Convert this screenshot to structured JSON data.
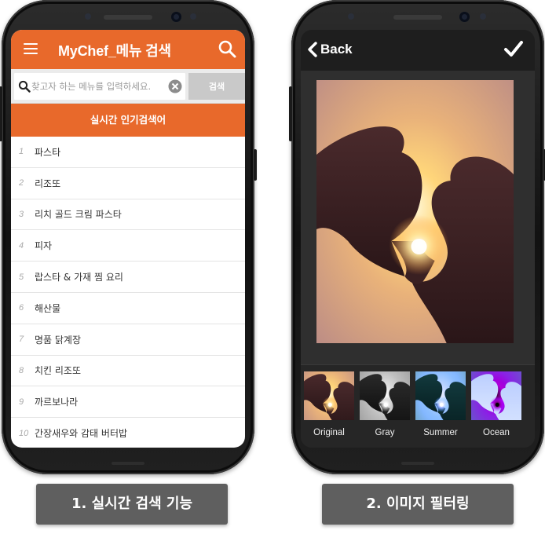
{
  "left_phone": {
    "app_title": "MyChef_메뉴 검색",
    "icons": {
      "menu": "hamburger-menu-icon",
      "search": "search-icon",
      "clear": "clear-icon",
      "input_search": "magnifier-icon"
    },
    "search": {
      "placeholder": "찾고자 하는 메뉴를 입력하세요.",
      "value": "",
      "submit_label": "검색"
    },
    "trending_header": "실시간 인기검색어",
    "trending": [
      {
        "rank": "1",
        "term": "파스타"
      },
      {
        "rank": "2",
        "term": "리조또"
      },
      {
        "rank": "3",
        "term": "리치 골드 크림 파스타"
      },
      {
        "rank": "4",
        "term": "피자"
      },
      {
        "rank": "5",
        "term": "랍스타 & 가재 찜 요리"
      },
      {
        "rank": "6",
        "term": "해산물"
      },
      {
        "rank": "7",
        "term": "명품 닭계장"
      },
      {
        "rank": "8",
        "term": "치킨 리조또"
      },
      {
        "rank": "9",
        "term": "까르보나라"
      },
      {
        "rank": "10",
        "term": "간장새우와 감태 버터밥"
      }
    ]
  },
  "right_phone": {
    "back_label": "Back",
    "icons": {
      "back": "chevron-left-icon",
      "confirm": "checkmark-icon"
    },
    "filters": [
      {
        "label": "Original",
        "selected": false
      },
      {
        "label": "Gray",
        "selected": false
      },
      {
        "label": "Summer",
        "selected": false
      },
      {
        "label": "Ocean",
        "selected": false
      }
    ]
  },
  "captions": {
    "left": "1. 실시간 검색 기능",
    "right": "2. 이미지 필터링"
  },
  "colors": {
    "accent": "#e8692b",
    "caption_bg": "#5f5f5f",
    "editor_bg": "#2f2f2f"
  }
}
